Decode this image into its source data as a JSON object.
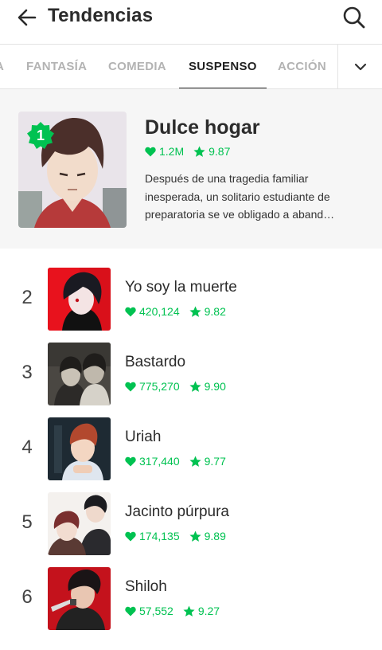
{
  "header": {
    "title": "Tendencias"
  },
  "tabs": [
    {
      "label": "A"
    },
    {
      "label": "FANTASÍA"
    },
    {
      "label": "COMEDIA"
    },
    {
      "label": "SUSPENSO"
    },
    {
      "label": "ACCIÓN"
    }
  ],
  "featured": {
    "rank": "1",
    "title": "Dulce hogar",
    "likes": "1.2M",
    "rating": "9.87",
    "description": "Después de una tragedia familiar inesperada, un solitario estudiante de preparatoria se ve obligado a aband…"
  },
  "list": [
    {
      "rank": "2",
      "title": "Yo soy la muerte",
      "likes": "420,124",
      "rating": "9.82"
    },
    {
      "rank": "3",
      "title": "Bastardo",
      "likes": "775,270",
      "rating": "9.90"
    },
    {
      "rank": "4",
      "title": "Uriah",
      "likes": "317,440",
      "rating": "9.77"
    },
    {
      "rank": "5",
      "title": "Jacinto púrpura",
      "likes": "174,135",
      "rating": "9.89"
    },
    {
      "rank": "6",
      "title": "Shiloh",
      "likes": "57,552",
      "rating": "9.27"
    }
  ],
  "colors": {
    "accent": "#00c251",
    "featured_bg": "#f6f6f6",
    "active_tab": "#222222",
    "inactive_tab": "#b3b3b3"
  },
  "icons": {
    "back": "arrow-left-icon",
    "search": "search-icon",
    "more": "chevron-down-icon",
    "like": "heart-icon",
    "rating": "star-icon"
  }
}
